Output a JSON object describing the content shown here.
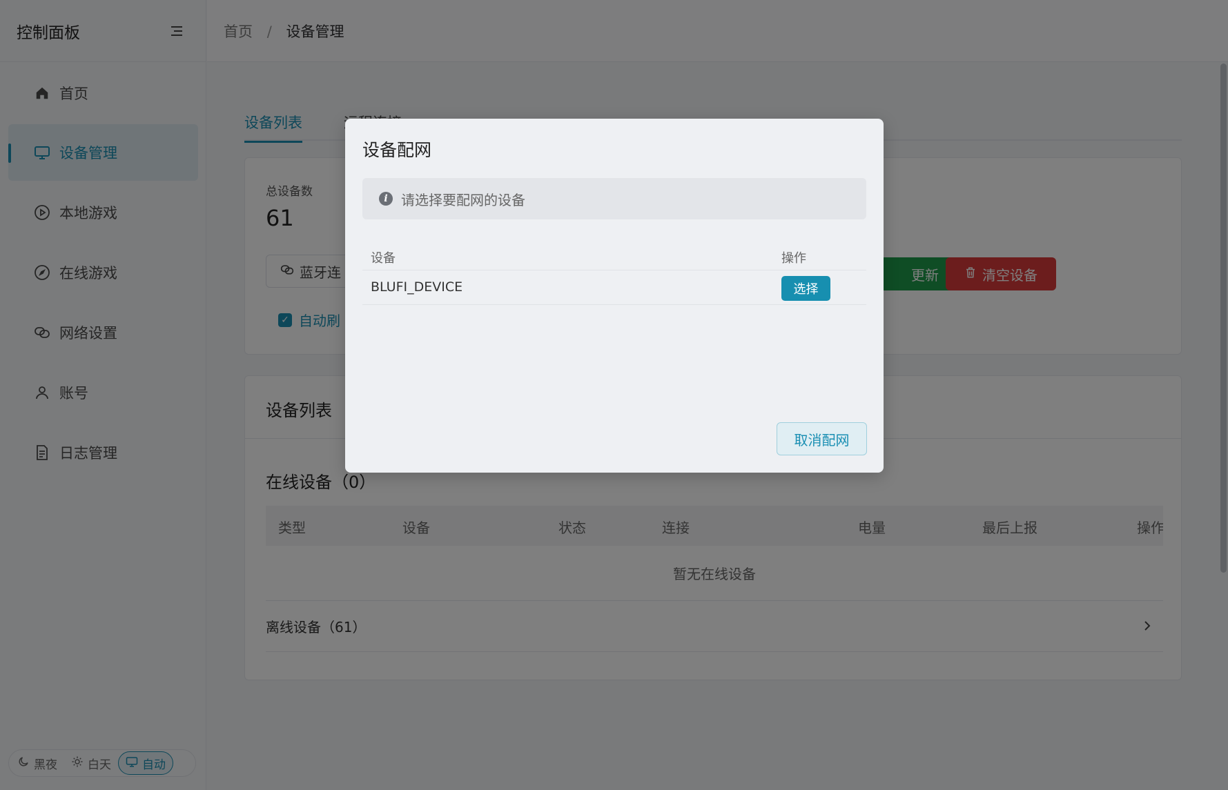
{
  "sidebar": {
    "title": "控制面板",
    "items": [
      {
        "label": "首页",
        "icon": "home-icon"
      },
      {
        "label": "设备管理",
        "icon": "monitor-icon",
        "active": true
      },
      {
        "label": "本地游戏",
        "icon": "play-circle-icon"
      },
      {
        "label": "在线游戏",
        "icon": "compass-icon"
      },
      {
        "label": "网络设置",
        "icon": "link-icon"
      },
      {
        "label": "账号",
        "icon": "user-icon"
      },
      {
        "label": "日志管理",
        "icon": "document-icon"
      }
    ],
    "theme": {
      "dark": "黑夜",
      "light": "白天",
      "auto": "自动",
      "selected": "自动"
    }
  },
  "header": {
    "breadcrumb": {
      "home": "首页",
      "separator": "/",
      "current": "设备管理"
    }
  },
  "tabs": [
    {
      "label": "设备列表",
      "active": true
    },
    {
      "label": "远程连接"
    }
  ],
  "stats": {
    "total_label": "总设备数",
    "total_value": "61",
    "bluetooth_button": "蓝牙连",
    "refresh_button": "更新",
    "clear_button": "清空设备",
    "auto_refresh_label": "自动刷",
    "auto_refresh_checked": true
  },
  "device_list": {
    "title": "设备列表",
    "online_title": "在线设备（0）",
    "columns": [
      "类型",
      "设备",
      "状态",
      "连接",
      "电量",
      "最后上报",
      "操作"
    ],
    "empty_text": "暂无在线设备",
    "offline_title": "离线设备（61）"
  },
  "modal": {
    "title": "设备配网",
    "alert": "请选择要配网的设备",
    "columns": {
      "device": "设备",
      "action": "操作"
    },
    "rows": [
      {
        "device": "BLUFI_DEVICE",
        "action": "选择"
      }
    ],
    "cancel_button": "取消配网"
  },
  "colors": {
    "primary": "#1a8fb3",
    "success": "#1f9a4a",
    "danger": "#d83a3a"
  }
}
